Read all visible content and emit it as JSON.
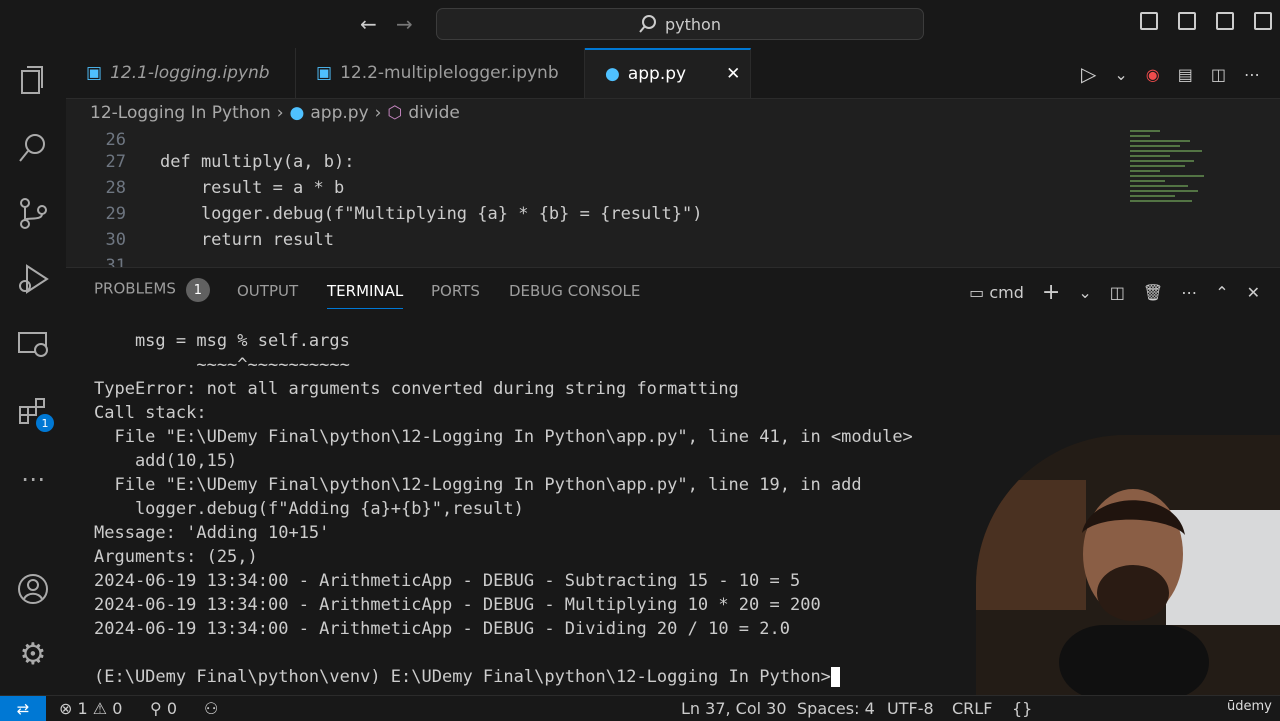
{
  "title_bar": {
    "search_label": "python"
  },
  "tabs": [
    {
      "label": "12.1-logging.ipynb"
    },
    {
      "label": "12.2-multiplelogger.ipynb"
    },
    {
      "label": "app.py"
    }
  ],
  "breadcrumb": [
    "12-Logging In Python",
    "app.py",
    "divide"
  ],
  "editor": {
    "lines": [
      {
        "number": "26",
        "code": ""
      },
      {
        "number": "27",
        "code": "def multiply(a, b):"
      },
      {
        "number": "28",
        "code": "    result = a * b"
      },
      {
        "number": "29",
        "code": "    logger.debug(f\"Multiplying {a} * {b} = {result}\")"
      },
      {
        "number": "30",
        "code": "    return result"
      },
      {
        "number": "31",
        "code": ""
      }
    ]
  },
  "panel": {
    "tabs": [
      {
        "label": "PROBLEMS",
        "count": "1"
      },
      {
        "label": "OUTPUT"
      },
      {
        "label": "TERMINAL"
      },
      {
        "label": "PORTS"
      },
      {
        "label": "DEBUG CONSOLE"
      }
    ],
    "shell": "cmd"
  },
  "terminal": {
    "lines": [
      "    msg = msg % self.args",
      "          ~~~~^~~~~~~~~~~",
      "TypeError: not all arguments converted during string formatting",
      "Call stack:",
      "  File \"E:\\UDemy Final\\python\\12-Logging In Python\\app.py\", line 41, in <module>",
      "    add(10,15)",
      "  File \"E:\\UDemy Final\\python\\12-Logging In Python\\app.py\", line 19, in add",
      "    logger.debug(f\"Adding {a}+{b}\",result)",
      "Message: 'Adding 10+15'",
      "Arguments: (25,)",
      "2024-06-19 13:34:00 - ArithmeticApp - DEBUG - Subtracting 15 - 10 = 5",
      "2024-06-19 13:34:00 - ArithmeticApp - DEBUG - Multiplying 10 * 20 = 200",
      "2024-06-19 13:34:00 - ArithmeticApp - DEBUG - Dividing 20 / 10 = 2.0",
      "",
      "(E:\\UDemy Final\\python\\venv) E:\\UDemy Final\\python\\12-Logging In Python>"
    ]
  },
  "activity_bar": {
    "extensions_badge": "1"
  },
  "status_bar": {
    "errors": "1",
    "warnings": "0",
    "ports": "0",
    "position": "Ln 37, Col 30",
    "spaces": "Spaces: 4",
    "encoding": "UTF-8",
    "eol": "CRLF",
    "watermark": "ūdemy"
  },
  "colors": {
    "accent": "#0078d4",
    "background": "#1f1f1f"
  }
}
